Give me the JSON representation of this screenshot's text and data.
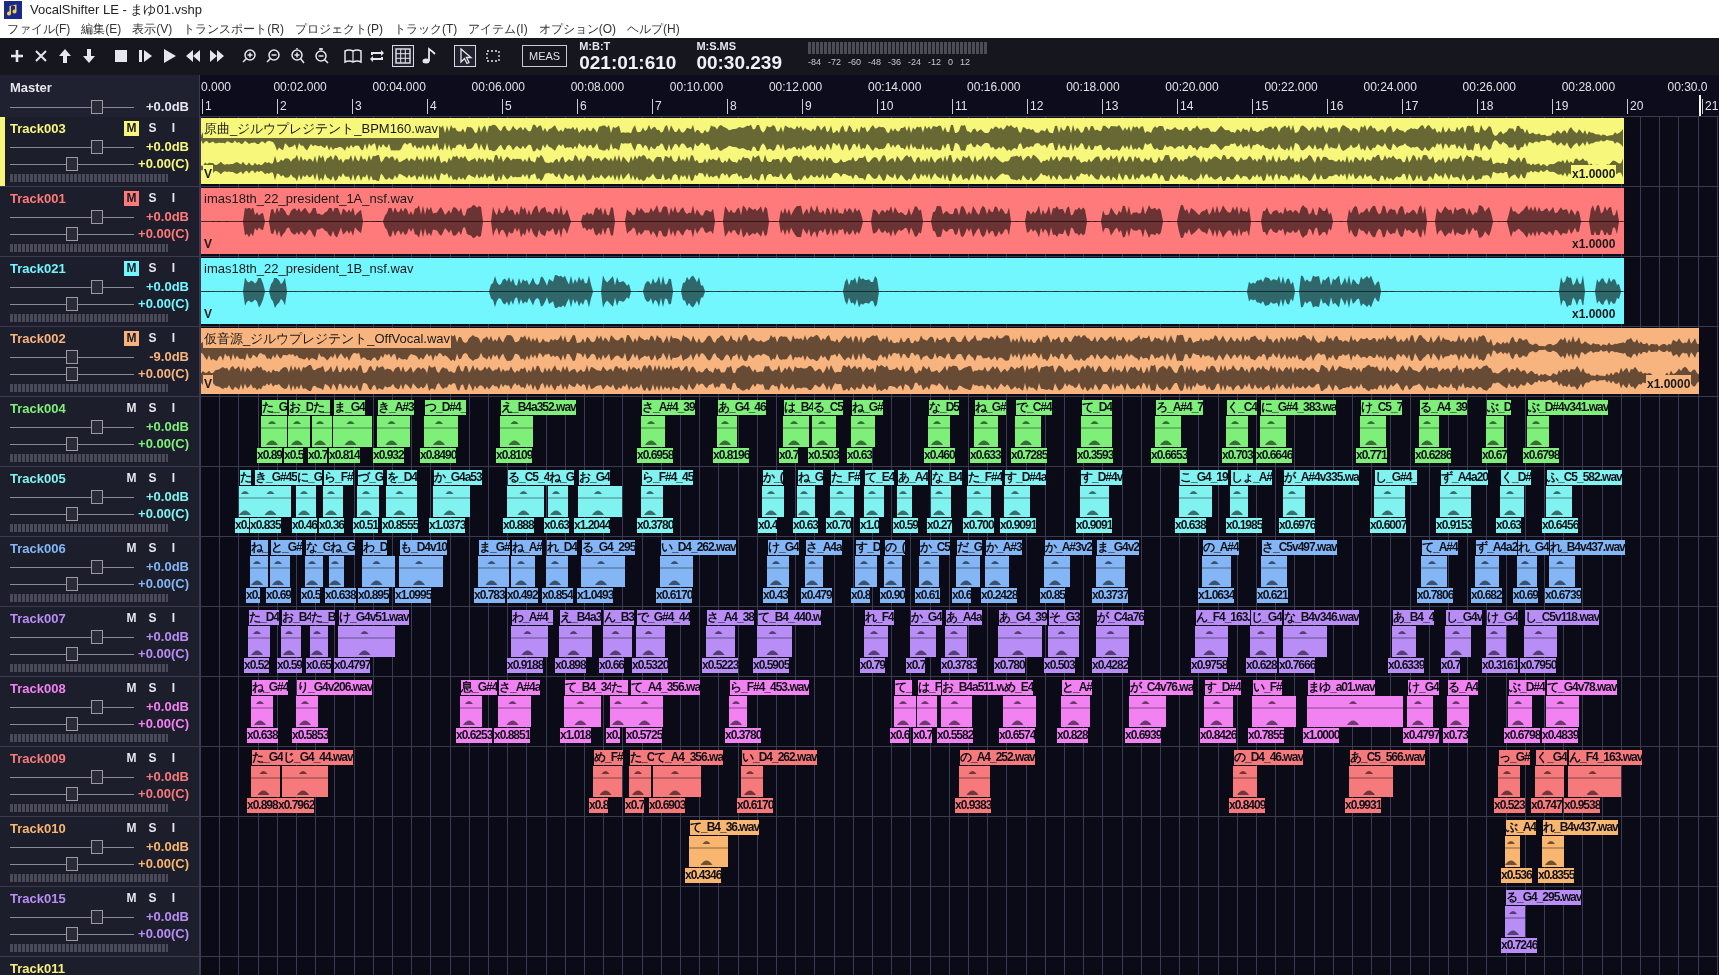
{
  "window": {
    "title": "VocalShifter LE - まゆ01.vshp"
  },
  "menu": [
    "ファイル(F)",
    "編集(E)",
    "表示(V)",
    "トランスポート(R)",
    "プロジェクト(P)",
    "トラック(T)",
    "アイテム(I)",
    "オプション(O)",
    "ヘルプ(H)"
  ],
  "toolbar": {
    "toggles": [
      {
        "kind": "grid",
        "on": true
      },
      {
        "kind": "pointer",
        "selected": true
      },
      {
        "kind": "range",
        "selected": false
      }
    ],
    "mode_button": "MEAS",
    "position": [
      {
        "label": "M:B:T",
        "value": "021:01:610"
      },
      {
        "label": "M:S.MS",
        "value": "00:30.239"
      }
    ],
    "meter_scale": [
      "-84",
      "-72",
      "-60",
      "-48",
      "-36",
      "-24",
      "-12",
      "0",
      "12"
    ]
  },
  "master": {
    "name": "Master",
    "gain": {
      "reading": "+0.0dB",
      "level": 0.7
    }
  },
  "ruler": {
    "times": [
      "0.000",
      "00:02.000",
      "00:04.000",
      "00:06.000",
      "00:08.000",
      "00:10.000",
      "00:12.000",
      "00:14.000",
      "00:16.000",
      "00:18.000",
      "00:20.000",
      "00:22.000",
      "00:24.000",
      "00:26.000",
      "00:28.000",
      "00:30.0"
    ],
    "measures": [
      "1",
      "2",
      "3",
      "4",
      "5",
      "6",
      "7",
      "8",
      "9",
      "10",
      "11",
      "12",
      "13",
      "14",
      "15",
      "16",
      "17",
      "18",
      "19",
      "20",
      "21"
    ]
  },
  "tracks": [
    {
      "name": "Track003",
      "kind": "audio",
      "color": "#f7f77c",
      "selected": true,
      "stereo": true,
      "buttons": [
        {
          "label": "M",
          "on": true
        },
        {
          "label": "S",
          "on": false
        },
        {
          "label": "I",
          "on": false
        }
      ],
      "gain": {
        "reading": "+0.0dB",
        "level": 0.7
      },
      "pan": {
        "reading": "+0.00(C)",
        "level": 0.5
      },
      "clip": {
        "name": "原曲_ジルウプレジテント_BPM160.wav",
        "marker": "V",
        "rate": "x1.0000"
      }
    },
    {
      "name": "Track001",
      "kind": "audio",
      "color": "#ff7a7a",
      "selected": false,
      "stereo": false,
      "buttons": [
        {
          "label": "M",
          "on": true
        },
        {
          "label": "S",
          "on": false
        },
        {
          "label": "I",
          "on": false
        }
      ],
      "gain": {
        "reading": "+0.0dB",
        "level": 0.7
      },
      "pan": {
        "reading": "+0.00(C)",
        "level": 0.5
      },
      "clip": {
        "name": "imas18th_22_president_1A_nsf.wav",
        "marker": "V",
        "rate": "x1.0000"
      }
    },
    {
      "name": "Track021",
      "kind": "audio",
      "color": "#72f6ff",
      "selected": false,
      "stereo": false,
      "buttons": [
        {
          "label": "M",
          "on": true
        },
        {
          "label": "S",
          "on": false
        },
        {
          "label": "I",
          "on": false
        }
      ],
      "gain": {
        "reading": "+0.0dB",
        "level": 0.7
      },
      "pan": {
        "reading": "+0.00(C)",
        "level": 0.5
      },
      "clip": {
        "name": "imas18th_22_president_1B_nsf.wav",
        "marker": "V",
        "rate": "x1.0000"
      }
    },
    {
      "name": "Track002",
      "kind": "audio",
      "color": "#f8b47e",
      "selected": false,
      "stereo": true,
      "buttons": [
        {
          "label": "M",
          "on": true
        },
        {
          "label": "S",
          "on": false
        },
        {
          "label": "I",
          "on": false
        }
      ],
      "gain": {
        "reading": "-9.0dB",
        "level": 0.5
      },
      "pan": {
        "reading": "+0.00(C)",
        "level": 0.5
      },
      "clip": {
        "name": "仮音源_ジルウプレジテント_OffVocal.wav",
        "marker": "V",
        "rate": "x1.0000"
      }
    },
    {
      "name": "Track004",
      "kind": "notes",
      "color": "#7ef07a",
      "selected": false,
      "buttons": [
        {
          "label": "M",
          "on": false
        },
        {
          "label": "S",
          "on": false
        },
        {
          "label": "I",
          "on": false
        }
      ],
      "gain": {
        "reading": "+0.0dB",
        "level": 0.7
      },
      "pan": {
        "reading": "+0.00(C)",
        "level": 0.5
      },
      "clips": [
        {
          "name": "た_G",
          "rate": "x0.89"
        },
        {
          "name": "お_D",
          "rate": "x0.5"
        },
        {
          "name": "た_",
          "rate": "x0.7"
        },
        {
          "name": "ま_G4",
          "rate": "x0.814"
        },
        {
          "name": "き_A#3",
          "rate": "x0.932"
        },
        {
          "name": "つ_D#4_",
          "rate": "x0.8490"
        },
        {
          "name": "え_B4a352.wav",
          "rate": "x0.8109"
        },
        {
          "name": "さ_A#4_39",
          "rate": "x0.6958"
        },
        {
          "name": "あ_G4_46",
          "rate": "x0.8196"
        },
        {
          "name": "は_B4",
          "rate": "x0.7"
        },
        {
          "name": "る_C5",
          "rate": "x0.503"
        },
        {
          "name": "ね_G#",
          "rate": "x0.63"
        },
        {
          "name": "な_D5",
          "rate": "x0.460"
        },
        {
          "name": "ね_G#",
          "rate": "x0.633"
        },
        {
          "name": "で_C#4",
          "rate": "x0.7285"
        },
        {
          "name": "て_D4",
          "rate": "x0.3593"
        },
        {
          "name": "ろ_A#4_7",
          "rate": "x0.6653"
        },
        {
          "name": "く_C4",
          "rate": "x0.703"
        },
        {
          "name": "に_G#4_383.wa",
          "rate": "x0.6646"
        },
        {
          "name": "け_C5_7",
          "rate": "x0.771"
        },
        {
          "name": "る_A4_39",
          "rate": "x0.6286"
        },
        {
          "name": "ぶ_D",
          "rate": "x0.67"
        },
        {
          "name": "ぶ_D#4v341.wav",
          "rate": "x0.6798"
        }
      ]
    },
    {
      "name": "Track005",
      "kind": "notes",
      "color": "#80f2f0",
      "selected": false,
      "buttons": [
        {
          "label": "M",
          "on": false
        },
        {
          "label": "S",
          "on": false
        },
        {
          "label": "I",
          "on": false
        }
      ],
      "gain": {
        "reading": "+0.0dB",
        "level": 0.7
      },
      "pan": {
        "reading": "+0.00(C)",
        "level": 0.5
      },
      "clips": [
        {
          "name": "た",
          "rate": "x0."
        },
        {
          "name": "き_G#45",
          "rate": "x0.835"
        },
        {
          "name": "に_G",
          "rate": "x0.46"
        },
        {
          "name": "ら_F#",
          "rate": "x0.36"
        },
        {
          "name": "づ_G",
          "rate": "x0.51"
        },
        {
          "name": "を_D4",
          "rate": "x0.8555"
        },
        {
          "name": "か_G4a53",
          "rate": "x1.0373"
        },
        {
          "name": "る_C5_4",
          "rate": "x0.888"
        },
        {
          "name": "ね_G",
          "rate": "x0.63"
        },
        {
          "name": "お_G4",
          "rate": "x1.2044"
        },
        {
          "name": "ら_F#4_45",
          "rate": "x0.3780"
        },
        {
          "name": "か_(",
          "rate": "x0.4"
        },
        {
          "name": "ね_G",
          "rate": "x0.63"
        },
        {
          "name": "た_F#",
          "rate": "x0.70"
        },
        {
          "name": "て_E4",
          "rate": "x1.0"
        },
        {
          "name": "あ_A4",
          "rate": "x0.59"
        },
        {
          "name": "な_B4",
          "rate": "x0.27"
        },
        {
          "name": "た_F#4",
          "rate": "x0.700"
        },
        {
          "name": "す_D#4a",
          "rate": "x0.9091"
        },
        {
          "name": "す_D#4v",
          "rate": "x0.9091"
        },
        {
          "name": "こ_G4_19",
          "rate": "x0.638"
        },
        {
          "name": "しょ_A#",
          "rate": "x0.1985"
        },
        {
          "name": "が_A#4v335.wa",
          "rate": "x0.6976"
        },
        {
          "name": "し_G#4_",
          "rate": "x0.6007"
        },
        {
          "name": "ず_A4a20",
          "rate": "x0.9153"
        },
        {
          "name": "く_D#",
          "rate": "x0.63"
        },
        {
          "name": "ふ_C5_582.wav",
          "rate": "x0.6456"
        }
      ]
    },
    {
      "name": "Track006",
      "kind": "notes",
      "color": "#84b6f6",
      "selected": false,
      "buttons": [
        {
          "label": "M",
          "on": false
        },
        {
          "label": "S",
          "on": false
        },
        {
          "label": "I",
          "on": false
        }
      ],
      "gain": {
        "reading": "+0.0dB",
        "level": 0.7
      },
      "pan": {
        "reading": "+0.00(C)",
        "level": 0.5
      },
      "clips": [
        {
          "name": "ね_",
          "rate": "x0."
        },
        {
          "name": "と_G#",
          "rate": "x0.69"
        },
        {
          "name": "な_G",
          "rate": "x0.5"
        },
        {
          "name": "ね_G",
          "rate": "x0.638"
        },
        {
          "name": "わ_D",
          "rate": "x0.895"
        },
        {
          "name": "も_D4v10",
          "rate": "x1.0995"
        },
        {
          "name": "ま_G#",
          "rate": "x0.783"
        },
        {
          "name": "ね_A#",
          "rate": "x0.492"
        },
        {
          "name": "れ_D4",
          "rate": "x0.854"
        },
        {
          "name": "る_G4_295",
          "rate": "x1.0493"
        },
        {
          "name": "い_D4_262.wav",
          "rate": "x0.6170"
        },
        {
          "name": "け_G4",
          "rate": "x0.43"
        },
        {
          "name": "さ_A4a",
          "rate": "x0.479"
        },
        {
          "name": "す_D",
          "rate": "x0.8"
        },
        {
          "name": "の_(",
          "rate": "x0.90"
        },
        {
          "name": "か_C5",
          "rate": "x0.61"
        },
        {
          "name": "だ_G",
          "rate": "x0.6"
        },
        {
          "name": "か_A#3",
          "rate": "x0.2428"
        },
        {
          "name": "か_A#3v2",
          "rate": "x0.85"
        },
        {
          "name": "ま_G4v2",
          "rate": "x0.3737"
        },
        {
          "name": "の_A#4",
          "rate": "x1.0634"
        },
        {
          "name": "さ_C5v497.wav",
          "rate": "x0.621"
        },
        {
          "name": "て_A#4",
          "rate": "x0.7806"
        },
        {
          "name": "ず_A4a2",
          "rate": "x0.682"
        },
        {
          "name": "れ_G4",
          "rate": "x0.69"
        },
        {
          "name": "れ_B4v437.wav",
          "rate": "x0.6739"
        }
      ]
    },
    {
      "name": "Track007",
      "kind": "notes",
      "color": "#b88ef6",
      "selected": false,
      "buttons": [
        {
          "label": "M",
          "on": false
        },
        {
          "label": "S",
          "on": false
        },
        {
          "label": "I",
          "on": false
        }
      ],
      "gain": {
        "reading": "+0.0dB",
        "level": 0.7
      },
      "pan": {
        "reading": "+0.00(C)",
        "level": 0.5
      },
      "clips": [
        {
          "name": "た_D4",
          "rate": "x0.52"
        },
        {
          "name": "お_B4",
          "rate": "x0.59"
        },
        {
          "name": "た_B",
          "rate": "x0.65"
        },
        {
          "name": "け_G4v51.wav",
          "rate": "x0.4797"
        },
        {
          "name": "わ_A#4_",
          "rate": "x0.9188"
        },
        {
          "name": "え_B4a3",
          "rate": "x0.898"
        },
        {
          "name": "ん_B3",
          "rate": "x0.66"
        },
        {
          "name": "で_G#4_44",
          "rate": "x0.5320"
        },
        {
          "name": "さ_A4_38",
          "rate": "x0.5223"
        },
        {
          "name": "て_B4_440.w",
          "rate": "x0.5905"
        },
        {
          "name": "れ_F4",
          "rate": "x0.79"
        },
        {
          "name": "か_G4",
          "rate": "x0.7"
        },
        {
          "name": "あ_A4a",
          "rate": "x0.3783"
        },
        {
          "name": "あ_G4_39",
          "rate": "x0.780"
        },
        {
          "name": "そ_G3",
          "rate": "x0.503"
        },
        {
          "name": "が_C4a76",
          "rate": "x0.4282"
        },
        {
          "name": "ん_F4_163.",
          "rate": "x0.9758"
        },
        {
          "name": "じ_G4",
          "rate": "x0.628"
        },
        {
          "name": "な_B4v346.wav",
          "rate": "x0.7666"
        },
        {
          "name": "あ_B4_4",
          "rate": "x0.6339"
        },
        {
          "name": "し_G4v",
          "rate": "x0.7"
        },
        {
          "name": "け_G4",
          "rate": "x0.3161"
        },
        {
          "name": "し_C5v118.wav",
          "rate": "x0.7950"
        }
      ]
    },
    {
      "name": "Track008",
      "kind": "notes",
      "color": "#f282f2",
      "selected": false,
      "buttons": [
        {
          "label": "M",
          "on": false
        },
        {
          "label": "S",
          "on": false
        },
        {
          "label": "I",
          "on": false
        }
      ],
      "gain": {
        "reading": "+0.0dB",
        "level": 0.7
      },
      "pan": {
        "reading": "+0.00(C)",
        "level": 0.5
      },
      "clips": [
        {
          "name": "ね_G#4",
          "rate": "x0.638"
        },
        {
          "name": "り_G4v206.wav",
          "rate": "x0.5853"
        },
        {
          "name": "息_G#4",
          "rate": "x0.6253"
        },
        {
          "name": "さ_A#4a",
          "rate": "x0.8851"
        },
        {
          "name": "て_B4_34",
          "rate": "x1.018"
        },
        {
          "name": "た_",
          "rate": "x0."
        },
        {
          "name": "て_A4_356.wa",
          "rate": "x0.5725"
        },
        {
          "name": "ら_F#4_453.wav",
          "rate": "x0.3780"
        },
        {
          "name": "て_",
          "rate": "x0.6"
        },
        {
          "name": "は_F",
          "rate": "x0.7"
        },
        {
          "name": "お_B4a511.w",
          "rate": "x0.5582"
        },
        {
          "name": "め_E4",
          "rate": "x0.6574"
        },
        {
          "name": "と_A#",
          "rate": "x0.828"
        },
        {
          "name": "が_C4v76.wa",
          "rate": "x0.6939"
        },
        {
          "name": "す_D#4",
          "rate": "x0.8426"
        },
        {
          "name": "い_F#",
          "rate": "x0.7855"
        },
        {
          "name": "まゆ_a01.wav",
          "rate": "x1.0000"
        },
        {
          "name": "け_G4",
          "rate": "x0.4797"
        },
        {
          "name": "る_A4",
          "rate": "x0.73"
        },
        {
          "name": "ぶ_D#4",
          "rate": "x0.6798"
        },
        {
          "name": "て_G4v78.wav",
          "rate": "x0.4839"
        }
      ]
    },
    {
      "name": "Track009",
      "kind": "notes",
      "color": "#f67a7c",
      "selected": false,
      "buttons": [
        {
          "label": "M",
          "on": false
        },
        {
          "label": "S",
          "on": false
        },
        {
          "label": "I",
          "on": false
        }
      ],
      "gain": {
        "reading": "+0.0dB",
        "level": 0.7
      },
      "pan": {
        "reading": "+0.00(C)",
        "level": 0.5
      },
      "clips": [
        {
          "name": "た_G4",
          "rate": "x0.898"
        },
        {
          "name": "じ_G4_44.wav",
          "rate": "x0.7962"
        },
        {
          "name": "め_F#",
          "rate": "x0.8"
        },
        {
          "name": "た_C",
          "rate": "x0.7"
        },
        {
          "name": "て_A4_356.wa",
          "rate": "x0.6903"
        },
        {
          "name": "い_D4_262.wav",
          "rate": "x0.6170"
        },
        {
          "name": "の_A4_252.wav",
          "rate": "x0.9383"
        },
        {
          "name": "の_D4_46.wav",
          "rate": "x0.8409"
        },
        {
          "name": "あ_C5_566.wav",
          "rate": "x0.9931"
        },
        {
          "name": "っ_G#",
          "rate": "x0.523"
        },
        {
          "name": "く_G4",
          "rate": "x0.747"
        },
        {
          "name": "ん_F4_163.wav",
          "rate": "x0.9538"
        }
      ]
    },
    {
      "name": "Track010",
      "kind": "notes",
      "color": "#f8b670",
      "selected": false,
      "buttons": [
        {
          "label": "M",
          "on": false
        },
        {
          "label": "S",
          "on": false
        },
        {
          "label": "I",
          "on": false
        }
      ],
      "gain": {
        "reading": "+0.0dB",
        "level": 0.7
      },
      "pan": {
        "reading": "+0.00(C)",
        "level": 0.5
      },
      "clips": [
        {
          "name": "て_B4_36.wav",
          "rate": "x0.4346"
        },
        {
          "name": "ぶ_A4",
          "rate": "x0.536"
        },
        {
          "name": "れ_B4v437.wav",
          "rate": "x0.8355"
        }
      ]
    },
    {
      "name": "Track015",
      "kind": "notes",
      "color": "#b88ef6",
      "selected": false,
      "buttons": [
        {
          "label": "M",
          "on": false
        },
        {
          "label": "S",
          "on": false
        },
        {
          "label": "I",
          "on": false
        }
      ],
      "gain": {
        "reading": "+0.0dB",
        "level": 0.7
      },
      "pan": {
        "reading": "+0.00(C)",
        "level": 0.5
      },
      "clips": [
        {
          "name": "る_G4_295.wav",
          "rate": "x0.7246"
        }
      ]
    },
    {
      "name": "Track011",
      "kind": "notes",
      "color": "#f7f07c",
      "selected": false
    }
  ]
}
